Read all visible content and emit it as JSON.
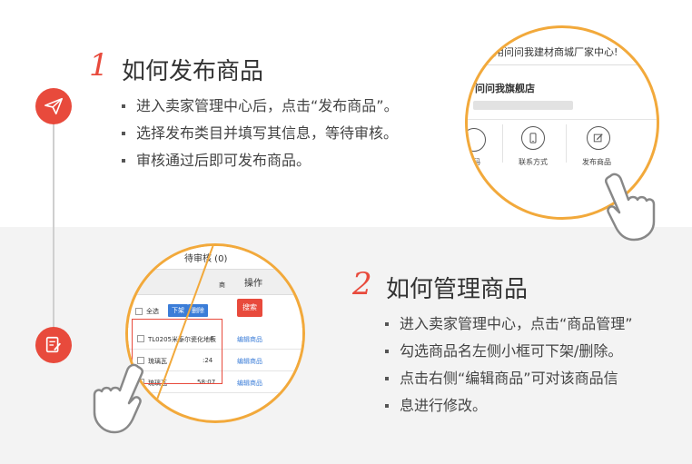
{
  "step1": {
    "number": "1",
    "title": "如何发布商品",
    "bullets": [
      "进入卖家管理中心后，点击“发布商品”。",
      "选择发布类目并填写其信息，等待审核。",
      "审核通过后即可发布商品。"
    ],
    "icon": "paper-plane-icon"
  },
  "step2": {
    "number": "2",
    "title": "如何管理商品",
    "bullets": [
      "进入卖家管理中心，点击“商品管理”",
      "勾选商品名左侧小框可下架/删除。",
      "点击右侧“编辑商品”可对该商品信",
      "息进行修改。"
    ],
    "icon": "edit-document-icon"
  },
  "zoom1": {
    "banner": "使用问问我建材商城厂家中心!",
    "shop_name": "问问我旗舰店",
    "icons": [
      {
        "label": "联系方式",
        "icon": "phone-icon"
      },
      {
        "label": "发布商品",
        "icon": "edit-icon"
      }
    ],
    "edge_label": "码"
  },
  "zoom2": {
    "tab_label": "待审核 (0)",
    "tab_prefix": ")",
    "col_action": "操作",
    "col_cut": "商",
    "select_all": "全选",
    "btn_offshelf": "下架",
    "btn_delete": "删除",
    "btn_search": "搜索",
    "rows": [
      {
        "name": "TL0205米泰尔瓷化地板",
        "time": "4",
        "action": "编辑商品"
      },
      {
        "name": "琉璃瓦",
        "time": ":24",
        "action": "编辑商品"
      },
      {
        "name": "琉璃瓦",
        "time": "58:07",
        "action": "编辑商品"
      }
    ]
  },
  "colors": {
    "accent": "#e84a3c",
    "ring": "#f2a93b",
    "link": "#3b7dd8"
  }
}
